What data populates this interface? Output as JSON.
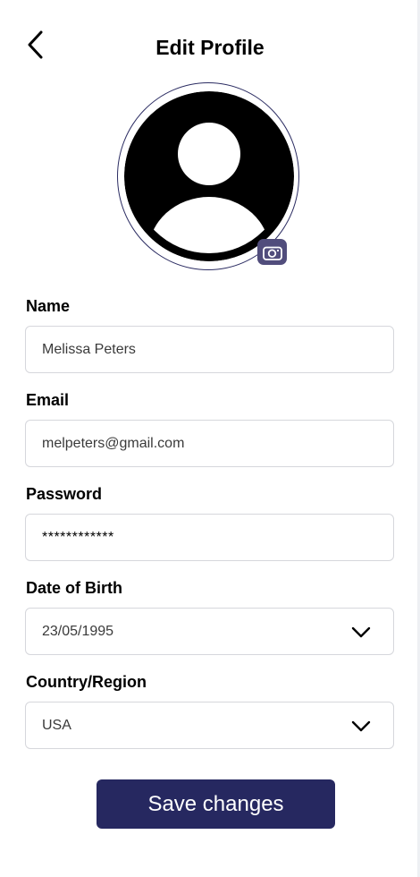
{
  "header": {
    "title": "Edit Profile",
    "back_icon": "chevron-left-icon"
  },
  "avatar": {
    "icon": "user-silhouette-icon",
    "camera_icon": "camera-icon",
    "ring_color": "#2b2c62",
    "camera_badge_color": "#514d7c"
  },
  "form": {
    "name": {
      "label": "Name",
      "value": "Melissa Peters"
    },
    "email": {
      "label": "Email",
      "value": "melpeters@gmail.com"
    },
    "password": {
      "label": "Password",
      "value": "************"
    },
    "dob": {
      "label": "Date of Birth",
      "value": "23/05/1995",
      "icon": "chevron-down-icon"
    },
    "country": {
      "label": "Country/Region",
      "value": "USA",
      "icon": "chevron-down-icon"
    }
  },
  "actions": {
    "save_label": "Save changes",
    "save_color": "#262860"
  }
}
